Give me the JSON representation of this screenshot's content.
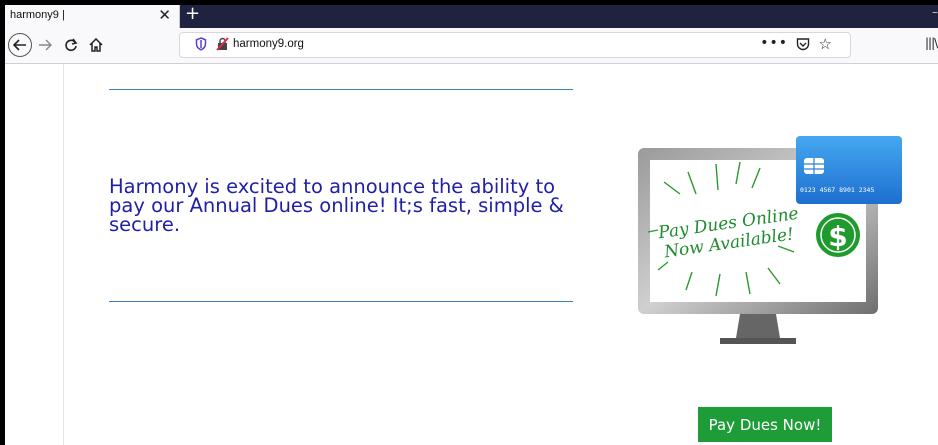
{
  "browser": {
    "tab_title": "harmony9 |",
    "tab_close": "✕",
    "new_tab": "+",
    "url": "harmony9.org",
    "url_more": "•••"
  },
  "page": {
    "headline": "Harmony is excited to announce the ability to pay our Annual Dues online! It;s fast, simple & secure.",
    "promo": {
      "line1": "Pay Dues Online",
      "line2": "Now Available!",
      "card_number": "0123 4567 8901 2345",
      "dollar": "$"
    },
    "button_label": "Pay Dues Now!"
  },
  "colors": {
    "headline": "#1f1fa8",
    "rule": "#3d7fb8",
    "button": "#1e9c37",
    "tabstrip": "#202340"
  }
}
